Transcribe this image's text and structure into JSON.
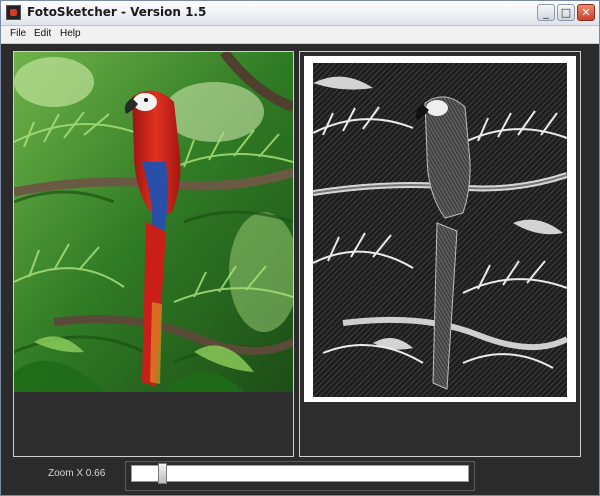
{
  "window": {
    "title": "FotoSketcher - Version 1.5",
    "controls": {
      "minimize": "_",
      "maximize": "□",
      "close": "✕"
    }
  },
  "menu": {
    "items": [
      "File",
      "Edit",
      "Help"
    ]
  },
  "panels": {
    "original": {
      "content": "photo of red macaw parrot among palm leaves"
    },
    "sketch": {
      "content": "pencil sketch version of the parrot photo"
    }
  },
  "status": {
    "zoom_label": "Zoom X 0.66",
    "zoom_slider_value": 0.08
  },
  "colors": {
    "window_bg": "#2b2b2b",
    "parrot_red": "#d42a1e",
    "leaf_green": "#3f9a2c"
  }
}
